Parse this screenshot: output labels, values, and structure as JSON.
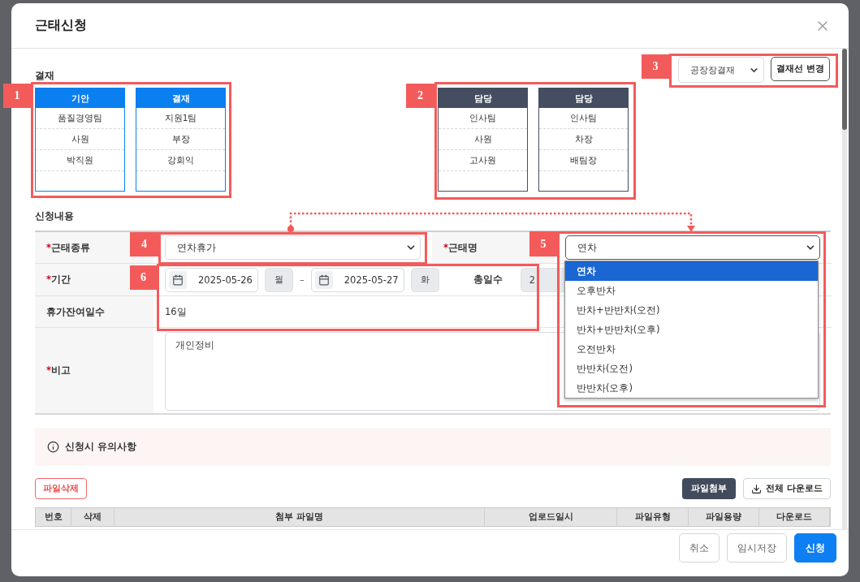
{
  "dialog": {
    "title": "근태신청"
  },
  "approval": {
    "label": "결재",
    "groups": [
      {
        "kind": "primary",
        "callout": "1",
        "columns": [
          {
            "header": "기안",
            "rows": [
              "품질경영팀",
              "사원",
              "박직원"
            ]
          },
          {
            "header": "결재",
            "rows": [
              "지원1팀",
              "부장",
              "강회익"
            ]
          }
        ]
      },
      {
        "kind": "secondary",
        "callout": "2",
        "columns": [
          {
            "header": "담당",
            "rows": [
              "인사팀",
              "사원",
              "고사원"
            ]
          },
          {
            "header": "담당",
            "rows": [
              "인사팀",
              "차장",
              "배팀장"
            ]
          }
        ]
      }
    ]
  },
  "approval_line": {
    "callout": "3",
    "select_value": "공장장결재",
    "button": "결재선 변경"
  },
  "form": {
    "label": "신청내용",
    "type": {
      "mark": "*",
      "label": "근태종류",
      "value": "연차휴가",
      "callout": "4"
    },
    "name": {
      "mark": "*",
      "label": "근태명",
      "value": "연차",
      "callout": "5",
      "expanded": true,
      "options": [
        {
          "label": "연차",
          "selected": true
        },
        {
          "label": "오후반차",
          "selected": false
        },
        {
          "label": "반차+반반차(오전)",
          "selected": false
        },
        {
          "label": "반차+반반차(오후)",
          "selected": false
        },
        {
          "label": "오전반차",
          "selected": false
        },
        {
          "label": "반반차(오전)",
          "selected": false
        },
        {
          "label": "반반차(오후)",
          "selected": false
        }
      ]
    },
    "period": {
      "mark": "*",
      "label": "기간",
      "callout": "6",
      "start": "2025-05-26",
      "start_day": "월",
      "separator": "–",
      "end": "2025-05-27",
      "end_day": "화",
      "total_label": "총일수",
      "total": "2"
    },
    "remaining": {
      "label": "휴가잔여일수",
      "value": "16일"
    },
    "note": {
      "mark": "*",
      "label": "비고",
      "value": "개인정비"
    }
  },
  "notice": {
    "text": "신청시 유의사항"
  },
  "files": {
    "delete_button": "파일삭제",
    "attach_button": "파일첨부",
    "download_all_button": "전체 다운로드",
    "columns": [
      "번호",
      "삭제",
      "첨부 파일명",
      "업로드일시",
      "파일유형",
      "파일용량",
      "다운로드"
    ]
  },
  "footer": {
    "buttons": [
      {
        "label": "취소",
        "kind": "default"
      },
      {
        "label": "임시저장",
        "kind": "default"
      },
      {
        "label": "신청",
        "kind": "primary"
      }
    ]
  }
}
